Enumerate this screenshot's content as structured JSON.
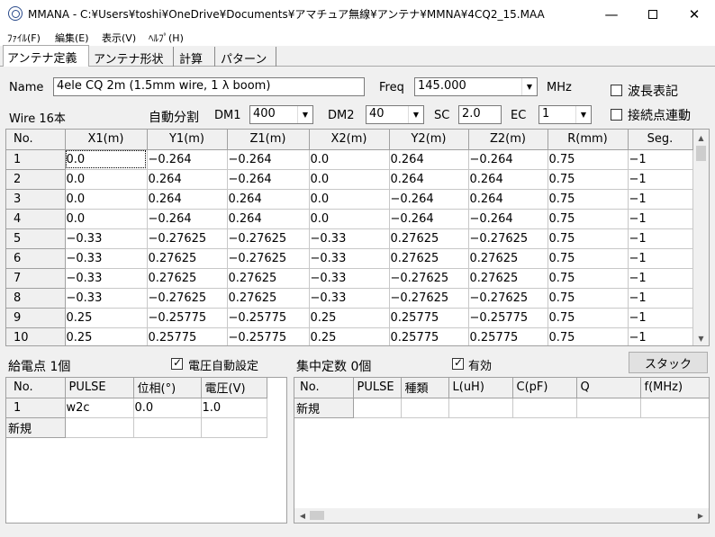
{
  "window": {
    "title": "MMANA - C:¥Users¥toshi¥OneDrive¥Documents¥アマチュア無線¥アンテナ¥MMNA¥4CQ2_15.MAA"
  },
  "menu": [
    {
      "label": "ﾌｧｲﾙ(F)"
    },
    {
      "label": "編集(E)"
    },
    {
      "label": "表示(V)"
    },
    {
      "label": "ﾍﾙﾌﾟ(H)"
    }
  ],
  "tabs": [
    {
      "label": "アンテナ定義",
      "active": true
    },
    {
      "label": "アンテナ形状"
    },
    {
      "label": "計算"
    },
    {
      "label": "パターン"
    }
  ],
  "antenna": {
    "name_label": "Name",
    "name_value": "4ele CQ 2m (1.5mm wire, 1 λ  boom)",
    "freq_label": "Freq",
    "freq_value": "145.000",
    "freq_unit": "MHz",
    "wavelength_label": "波長表記",
    "wire_count_label": "Wire 16本",
    "auto_split_label": "自動分割",
    "dm1_label": "DM1",
    "dm1_value": "400",
    "dm2_label": "DM2",
    "dm2_value": "40",
    "sc_label": "SC",
    "sc_value": "2.0",
    "ec_label": "EC",
    "ec_value": "1",
    "connect_label": "接続点連動"
  },
  "wire_table": {
    "columns": [
      "No.",
      "X1(m)",
      "Y1(m)",
      "Z1(m)",
      "X2(m)",
      "Y2(m)",
      "Z2(m)",
      "R(mm)",
      "Seg."
    ],
    "rows": [
      [
        "1",
        "0.0",
        "−0.264",
        "−0.264",
        "0.0",
        "0.264",
        "−0.264",
        "0.75",
        "−1"
      ],
      [
        "2",
        "0.0",
        "0.264",
        "−0.264",
        "0.0",
        "0.264",
        "0.264",
        "0.75",
        "−1"
      ],
      [
        "3",
        "0.0",
        "0.264",
        "0.264",
        "0.0",
        "−0.264",
        "0.264",
        "0.75",
        "−1"
      ],
      [
        "4",
        "0.0",
        "−0.264",
        "0.264",
        "0.0",
        "−0.264",
        "−0.264",
        "0.75",
        "−1"
      ],
      [
        "5",
        "−0.33",
        "−0.27625",
        "−0.27625",
        "−0.33",
        "0.27625",
        "−0.27625",
        "0.75",
        "−1"
      ],
      [
        "6",
        "−0.33",
        "0.27625",
        "−0.27625",
        "−0.33",
        "0.27625",
        "0.27625",
        "0.75",
        "−1"
      ],
      [
        "7",
        "−0.33",
        "0.27625",
        "0.27625",
        "−0.33",
        "−0.27625",
        "0.27625",
        "0.75",
        "−1"
      ],
      [
        "8",
        "−0.33",
        "−0.27625",
        "0.27625",
        "−0.33",
        "−0.27625",
        "−0.27625",
        "0.75",
        "−1"
      ],
      [
        "9",
        "0.25",
        "−0.25775",
        "−0.25775",
        "0.25",
        "0.25775",
        "−0.25775",
        "0.75",
        "−1"
      ],
      [
        "10",
        "0.25",
        "0.25775",
        "−0.25775",
        "0.25",
        "0.25775",
        "0.25775",
        "0.75",
        "−1"
      ]
    ]
  },
  "feed": {
    "title": "給電点 1個",
    "auto_voltage_label": "電圧自動設定",
    "auto_voltage_checked": true,
    "columns": [
      "No.",
      "PULSE",
      "位相(°)",
      "電圧(V)"
    ],
    "rows": [
      [
        "1",
        "w2c",
        "0.0",
        "1.0"
      ]
    ],
    "new_row": "新規"
  },
  "load": {
    "title": "集中定数 0個",
    "enabled_label": "有効",
    "enabled_checked": true,
    "stack_button": "スタック",
    "columns": [
      "No.",
      "PULSE",
      "種類",
      "L(uH)",
      "C(pF)",
      "Q",
      "f(MHz)"
    ],
    "new_row": "新規"
  },
  "icons": {
    "minimize": "minimize-icon",
    "maximize": "maximize-icon",
    "close": "close-icon",
    "dropdown": "chevron-down-icon"
  }
}
